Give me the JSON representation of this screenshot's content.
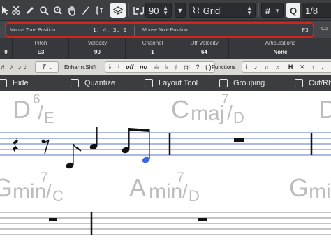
{
  "toolbar": {
    "quantize_value": "90",
    "grid_label": "Grid",
    "hash_label": "#",
    "q_label": "Q",
    "q_value": "1/8",
    "icons": [
      "select-tool-icon",
      "scissors-icon",
      "pencil-icon",
      "magnify-icon",
      "glue-icon",
      "hand-icon",
      "draw-icon",
      "text-tool-icon",
      "layers-icon",
      "record-icon",
      "note-icon"
    ]
  },
  "info_bar": {
    "time_label": "Mouse Time Position",
    "time_value": "1. 4. 3.   0",
    "note_label": "Mouse Note Position",
    "note_value": "F3",
    "cut_label": "Cu"
  },
  "info_line": {
    "cells": [
      {
        "header": "",
        "value": "0"
      },
      {
        "header": "Pitch",
        "value": "E3"
      },
      {
        "header": "Velocity",
        "value": "90"
      },
      {
        "header": "Channel",
        "value": "1"
      },
      {
        "header": "Off Velocity",
        "value": "64"
      },
      {
        "header": "Articulations",
        "value": "None"
      }
    ]
  },
  "symbols": {
    "enharm_label": "Enharm.Shift",
    "functions_label": "Functions",
    "t_label": "T",
    "off_label": "off",
    "no_label": "no"
  },
  "options": {
    "hide": "Hide",
    "quantize": "Quantize",
    "layout_tool": "Layout Tool",
    "grouping": "Grouping",
    "cut_rh": "Cut/Rh"
  },
  "score": {
    "chords_row1": [
      {
        "root": "D",
        "sup": "6",
        "bass": "E"
      },
      {
        "root": "C",
        "qual": "maj",
        "sup": "7",
        "bass": "D"
      },
      {
        "root": "D"
      }
    ],
    "chords_row2": [
      {
        "root": "G",
        "qual": "min",
        "sup": "7",
        "bass": "C"
      },
      {
        "root": "A",
        "qual": "min",
        "sup": "7",
        "bass": "D"
      },
      {
        "root": "G",
        "qual": "min"
      }
    ]
  },
  "colors": {
    "toolbar_bg": "#3d3f42",
    "highlight_border": "#d6221c",
    "staff_line": "#5b6fd0",
    "selected_note": "#3a66e0",
    "chord_text": "#bdbdbd"
  }
}
